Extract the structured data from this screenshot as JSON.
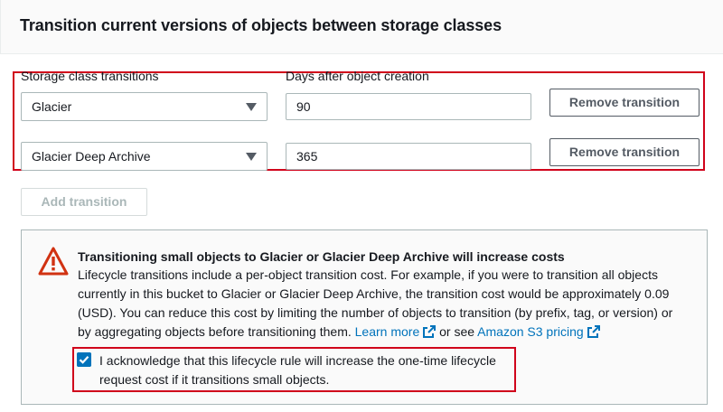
{
  "section": {
    "title": "Transition current versions of objects between storage classes"
  },
  "transitions": {
    "class_label": "Storage class transitions",
    "days_label": "Days after object creation",
    "rows": [
      {
        "storage_class": "Glacier",
        "days": "90",
        "remove_label": "Remove transition"
      },
      {
        "storage_class": "Glacier Deep Archive",
        "days": "365",
        "remove_label": "Remove transition"
      }
    ],
    "add_label": "Add transition"
  },
  "alert": {
    "title": "Transitioning small objects to Glacier or Glacier Deep Archive will increase costs",
    "lines": [
      "Lifecycle transitions include a per-object transition cost. For example, if you were to transition all objects",
      "currently in this bucket to Glacier or Glacier Deep Archive, the transition cost would be approximately 0.09",
      "(USD). You can reduce this cost by limiting the number of objects to transition (by prefix, tag, or version) or"
    ],
    "last_line_prefix": "by aggregating objects before transitioning them. ",
    "learn_more": "Learn more",
    "or_see": " or see ",
    "pricing_link": "Amazon S3 pricing",
    "icon": "warning-triangle-icon",
    "link_icon": "external-link-icon"
  },
  "acknowledge": {
    "checked": true,
    "lines": [
      "I acknowledge that this lifecycle rule will increase the one-time lifecycle",
      "request cost if it transitions small objects."
    ]
  },
  "colors": {
    "highlight": "#d0021b",
    "link": "#0073bb",
    "warning": "#d13212"
  }
}
